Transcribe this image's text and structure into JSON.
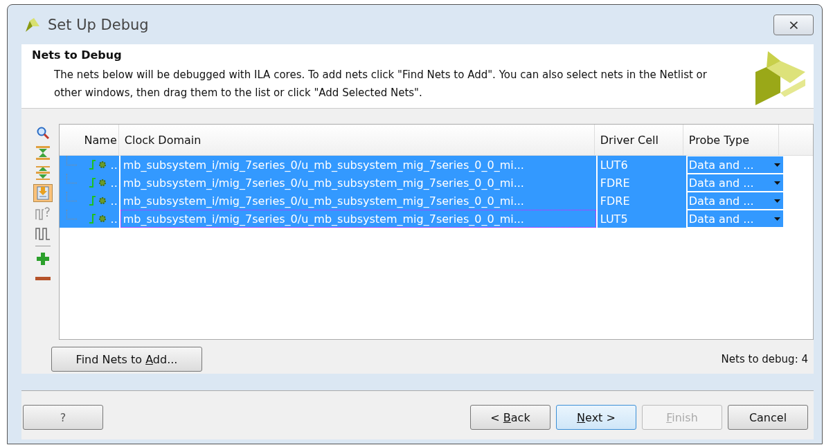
{
  "window": {
    "title": "Set Up Debug",
    "close": "⨯"
  },
  "header": {
    "title": "Nets to Debug",
    "description": "The nets below will be debugged with ILA cores. To add nets click \"Find Nets to Add\". You can also select nets in the Netlist or other windows, then drag them to the list or click \"Add Selected Nets\"."
  },
  "toolbar": [
    {
      "kind": "search",
      "selected": false
    },
    {
      "kind": "collapse",
      "selected": false
    },
    {
      "kind": "expand",
      "selected": false
    },
    {
      "kind": "import",
      "selected": true
    },
    {
      "kind": "probe-unknown",
      "selected": false
    },
    {
      "kind": "probe",
      "selected": false
    },
    {
      "kind": "add",
      "selected": false
    },
    {
      "kind": "remove",
      "selected": false
    }
  ],
  "table": {
    "columns": [
      "Name",
      "Clock Domain",
      "Driver Cell",
      "Probe Type"
    ],
    "rows": [
      {
        "name": "..",
        "clock_domain": "mb_subsystem_i/mig_7series_0/u_mb_subsystem_mig_7series_0_0_mi...",
        "driver_cell": "LUT6",
        "probe_type": "Data and ...",
        "selected": true,
        "focused": false
      },
      {
        "name": "..",
        "clock_domain": "mb_subsystem_i/mig_7series_0/u_mb_subsystem_mig_7series_0_0_mi...",
        "driver_cell": "FDRE",
        "probe_type": "Data and ...",
        "selected": true,
        "focused": false
      },
      {
        "name": "..",
        "clock_domain": "mb_subsystem_i/mig_7series_0/u_mb_subsystem_mig_7series_0_0_mi...",
        "driver_cell": "FDRE",
        "probe_type": "Data and ...",
        "selected": true,
        "focused": false
      },
      {
        "name": "..",
        "clock_domain": "mb_subsystem_i/mig_7series_0/u_mb_subsystem_mig_7series_0_0_mi...",
        "driver_cell": "LUT5",
        "probe_type": "Data and ...",
        "selected": true,
        "focused": true
      }
    ]
  },
  "find_button": {
    "before": "Find Nets to ",
    "key": "A",
    "after": "dd..."
  },
  "count": "Nets to debug: 4",
  "help_button": "?",
  "buttons": [
    {
      "before": "< ",
      "key": "B",
      "after": "ack",
      "disabled": false,
      "default": false
    },
    {
      "key": "N",
      "after": "ext >",
      "disabled": false,
      "default": true
    },
    {
      "key": "F",
      "after": "inish",
      "disabled": true,
      "default": false
    },
    {
      "before": "Cancel",
      "disabled": false,
      "default": false
    }
  ]
}
